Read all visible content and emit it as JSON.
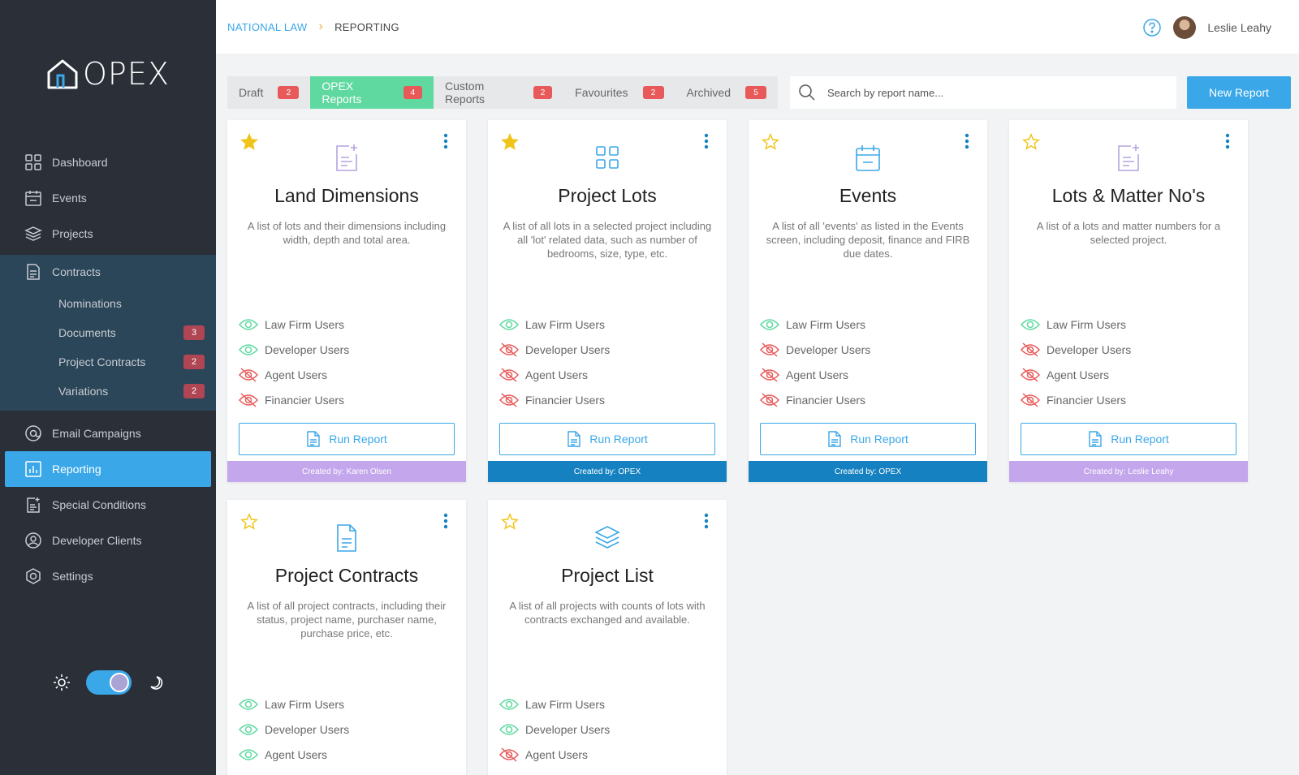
{
  "app": {
    "logo_text": "OPEX"
  },
  "breadcrumb": {
    "parent": "NATIONAL LAW",
    "current": "REPORTING"
  },
  "user": {
    "name": "Leslie Leahy"
  },
  "sidebar": {
    "items": [
      {
        "label": "Dashboard"
      },
      {
        "label": "Events"
      },
      {
        "label": "Projects"
      },
      {
        "label": "Contracts"
      },
      {
        "label": "Email Campaigns"
      },
      {
        "label": "Reporting"
      },
      {
        "label": "Special Conditions"
      },
      {
        "label": "Developer Clients"
      },
      {
        "label": "Settings"
      }
    ],
    "contracts_sub": [
      {
        "label": "Nominations",
        "count": ""
      },
      {
        "label": "Documents",
        "count": "3"
      },
      {
        "label": "Project Contracts",
        "count": "2"
      },
      {
        "label": "Variations",
        "count": "2"
      }
    ]
  },
  "tabs": [
    {
      "label": "Draft",
      "count": "2"
    },
    {
      "label": "OPEX Reports",
      "count": "4"
    },
    {
      "label": "Custom Reports",
      "count": "2"
    },
    {
      "label": "Favourites",
      "count": "2"
    },
    {
      "label": "Archived",
      "count": "5"
    }
  ],
  "search": {
    "placeholder": "Search by report name..."
  },
  "new_report_label": "New Report",
  "run_label": "Run Report",
  "permissions_labels": [
    "Law Firm Users",
    "Developer Users",
    "Agent Users",
    "Financier Users"
  ],
  "colors": {
    "accent": "#3aa7e8",
    "active_tab": "#5fd9a0",
    "star": "#f0c419",
    "visible": "#5fd9a0",
    "hidden": "#e85a5a",
    "creator_custom": "#c3a6ec",
    "creator_opex": "#1581c0"
  },
  "cards": [
    {
      "title": "Land Dimensions",
      "description": "A list of lots and their dimensions including width, depth and total area.",
      "favourite": true,
      "icon": "file-plus-icon",
      "permissions": [
        true,
        true,
        false,
        false
      ],
      "creator": "Created by: Karen Olsen",
      "creator_type": "custom"
    },
    {
      "title": "Project Lots",
      "description": "A list of all lots in a selected project including all 'lot' related data, such as number of bedrooms, size, type, etc.",
      "favourite": true,
      "icon": "grid-icon",
      "permissions": [
        true,
        false,
        false,
        false
      ],
      "creator": "Created by: OPEX",
      "creator_type": "opex"
    },
    {
      "title": "Events",
      "description": "A list of all 'events' as listed in the Events screen, including deposit, finance and FIRB due dates.",
      "favourite": false,
      "icon": "calendar-icon",
      "permissions": [
        true,
        false,
        false,
        false
      ],
      "creator": "Created by: OPEX",
      "creator_type": "opex"
    },
    {
      "title": "Lots & Matter No's",
      "description": "A list of a lots and matter numbers for a selected project.",
      "favourite": false,
      "icon": "file-plus-icon",
      "permissions": [
        true,
        false,
        false,
        false
      ],
      "creator": "Created by: Leslie Leahy",
      "creator_type": "custom"
    },
    {
      "title": "Project Contracts",
      "description": "A list of all project contracts, including their status, project name, purchaser name, purchase price, etc.",
      "favourite": false,
      "icon": "document-icon",
      "permissions": [
        true,
        true,
        true
      ],
      "creator": "",
      "creator_type": ""
    },
    {
      "title": "Project List",
      "description": "A list of all projects with counts of lots with contracts exchanged and available.",
      "favourite": false,
      "icon": "layers-icon",
      "permissions": [
        true,
        true,
        false
      ],
      "creator": "",
      "creator_type": ""
    }
  ]
}
